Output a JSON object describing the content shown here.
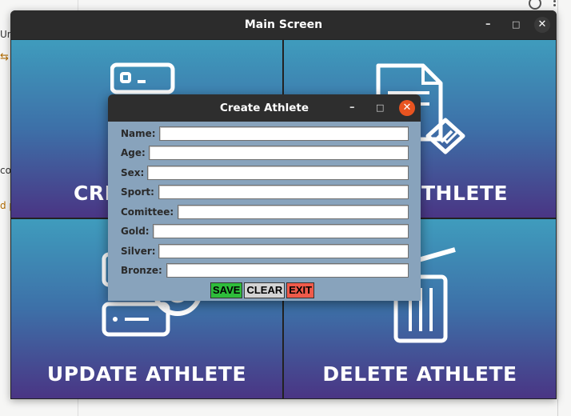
{
  "background": {
    "fragments": [
      "Uni",
      "co",
      "d p"
    ]
  },
  "main_window": {
    "title": "Main Screen",
    "controls": {
      "minimize": "–",
      "maximize": "□",
      "close": "✕"
    },
    "tiles": [
      {
        "label": "CRE",
        "icon": "server-icon"
      },
      {
        "label": "THLETE",
        "icon": "document-check-icon"
      },
      {
        "label": "UPDATE ATHLETE",
        "icon": "server-settings-icon"
      },
      {
        "label": "DELETE ATHLETE",
        "icon": "trash-icon"
      }
    ],
    "accent": {
      "close": "#3a3a3a",
      "tile_top": "#3f9cbd",
      "tile_bottom": "#4a3584"
    }
  },
  "dialog": {
    "title": "Create Athlete",
    "controls": {
      "minimize": "–",
      "maximize": "□",
      "close": "✕"
    },
    "close_color": "#e95420",
    "fields": [
      {
        "label": "Name:",
        "value": ""
      },
      {
        "label": "Age:",
        "value": ""
      },
      {
        "label": "Sex:",
        "value": ""
      },
      {
        "label": "Sport:",
        "value": ""
      },
      {
        "label": "Comittee:",
        "value": ""
      },
      {
        "label": "Gold:",
        "value": ""
      },
      {
        "label": "Silver:",
        "value": ""
      },
      {
        "label": "Bronze:",
        "value": ""
      }
    ],
    "buttons": {
      "save": {
        "label": "SAVE",
        "color": "#2ebd3b"
      },
      "clear": {
        "label": "CLEAR",
        "color": "#d4d4d4"
      },
      "exit": {
        "label": "EXIT",
        "color": "#ef5a4a"
      }
    }
  }
}
